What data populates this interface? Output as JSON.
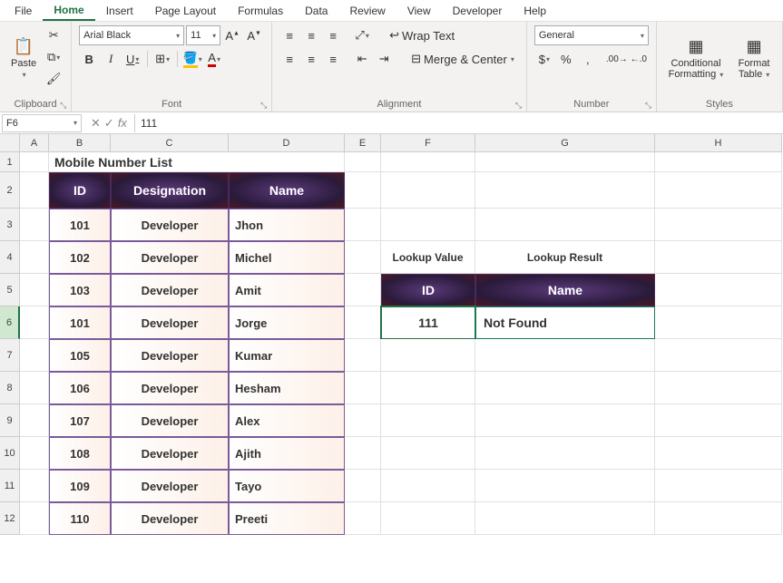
{
  "menu": {
    "file": "File",
    "home": "Home",
    "insert": "Insert",
    "pageLayout": "Page Layout",
    "formulas": "Formulas",
    "data": "Data",
    "review": "Review",
    "view": "View",
    "developer": "Developer",
    "help": "Help"
  },
  "ribbon": {
    "clipboard": {
      "paste": "Paste",
      "label": "Clipboard"
    },
    "font": {
      "name": "Arial Black",
      "size": "11",
      "bold": "B",
      "italic": "I",
      "underline": "U",
      "label": "Font"
    },
    "alignment": {
      "wrap": "Wrap Text",
      "merge": "Merge & Center",
      "label": "Alignment"
    },
    "number": {
      "format": "General",
      "percent": "%",
      "label": "Number"
    },
    "styles": {
      "cond": "Conditional Formatting",
      "table": "Format Table",
      "label": "Styles"
    }
  },
  "namebox": "F6",
  "formula": "111",
  "columns": [
    "A",
    "B",
    "C",
    "D",
    "E",
    "F",
    "G",
    "H"
  ],
  "rows": [
    "1",
    "2",
    "3",
    "4",
    "5",
    "6",
    "7",
    "8",
    "9",
    "10",
    "11",
    "12"
  ],
  "title": "Mobile Number List",
  "headers": {
    "id": "ID",
    "designation": "Designation",
    "name": "Name"
  },
  "data": [
    {
      "id": "101",
      "designation": "Developer",
      "name": "Jhon"
    },
    {
      "id": "102",
      "designation": "Developer",
      "name": "Michel"
    },
    {
      "id": "103",
      "designation": "Developer",
      "name": "Amit"
    },
    {
      "id": "101",
      "designation": "Developer",
      "name": "Jorge"
    },
    {
      "id": "105",
      "designation": "Developer",
      "name": "Kumar"
    },
    {
      "id": "106",
      "designation": "Developer",
      "name": "Hesham"
    },
    {
      "id": "107",
      "designation": "Developer",
      "name": "Alex"
    },
    {
      "id": "108",
      "designation": "Developer",
      "name": "Ajith"
    },
    {
      "id": "109",
      "designation": "Developer",
      "name": "Tayo"
    },
    {
      "id": "110",
      "designation": "Developer",
      "name": "Preeti"
    }
  ],
  "lookup": {
    "valLabel": "Lookup Value",
    "resLabel": "Lookup Result",
    "idHdr": "ID",
    "nameHdr": "Name",
    "idVal": "111",
    "result": "Not Found"
  }
}
